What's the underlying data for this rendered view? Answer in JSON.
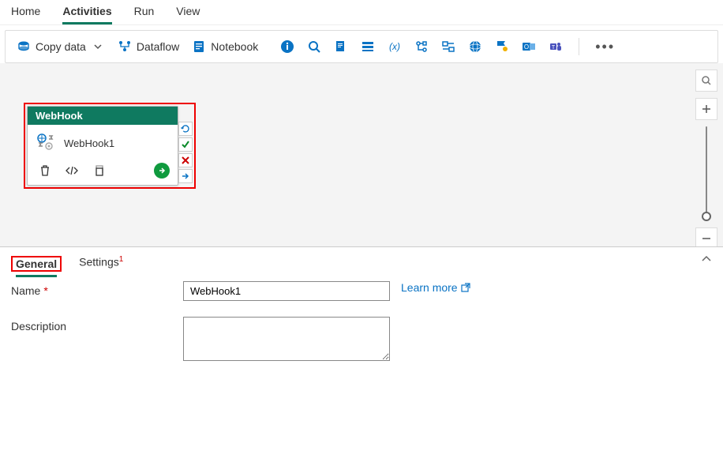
{
  "topnav": {
    "tabs": [
      "Home",
      "Activities",
      "Run",
      "View"
    ],
    "active": "Activities"
  },
  "toolbar": {
    "copy_data": "Copy data",
    "dataflow": "Dataflow",
    "notebook": "Notebook"
  },
  "node": {
    "header": "WebHook",
    "title": "WebHook1"
  },
  "props": {
    "tabs": {
      "general": "General",
      "settings": "Settings",
      "settings_badge": "1"
    },
    "name_label": "Name",
    "name_value": "WebHook1",
    "learn_more": "Learn more",
    "desc_label": "Description",
    "desc_value": ""
  }
}
